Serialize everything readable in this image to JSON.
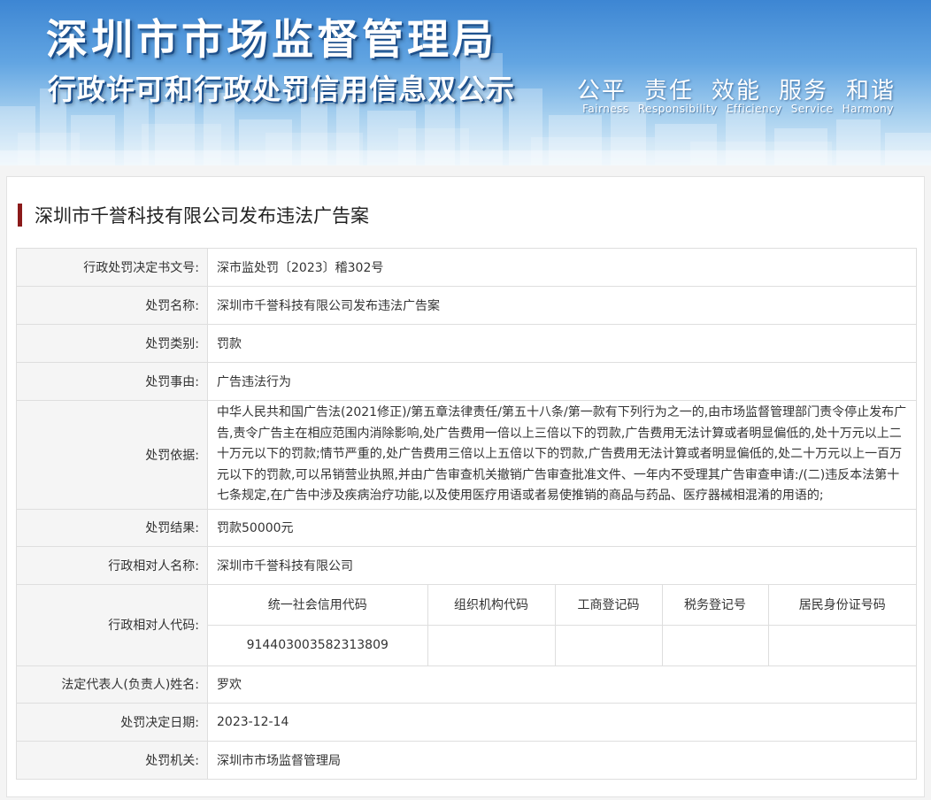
{
  "banner": {
    "title": "深圳市市场监督管理局",
    "subtitle": "行政许可和行政处罚信用信息双公示",
    "slogan_cn": [
      "公平",
      "责任",
      "效能",
      "服务",
      "和谐"
    ],
    "slogan_en": [
      "Fairness",
      "Responsibility",
      "Efficiency",
      "Service",
      "Harmony"
    ]
  },
  "case_title": "深圳市千誉科技有限公司发布违法广告案",
  "fields": {
    "doc_no": {
      "label": "行政处罚决定书文号:",
      "value": "深市监处罚〔2023〕稽302号"
    },
    "name": {
      "label": "处罚名称:",
      "value": "深圳市千誉科技有限公司发布违法广告案"
    },
    "category": {
      "label": "处罚类别:",
      "value": "罚款"
    },
    "reason": {
      "label": "处罚事由:",
      "value": "广告违法行为"
    },
    "basis": {
      "label": "处罚依据:",
      "value": "中华人民共和国广告法(2021修正)/第五章法律责任/第五十八条/第一款有下列行为之一的,由市场监督管理部门责令停止发布广告,责令广告主在相应范围内消除影响,处广告费用一倍以上三倍以下的罚款,广告费用无法计算或者明显偏低的,处十万元以上二十万元以下的罚款;情节严重的,处广告费用三倍以上五倍以下的罚款,广告费用无法计算或者明显偏低的,处二十万元以上一百万元以下的罚款,可以吊销营业执照,并由广告审查机关撤销广告审查批准文件、一年内不受理其广告审查申请:/(二)违反本法第十七条规定,在广告中涉及疾病治疗功能,以及使用医疗用语或者易使推销的商品与药品、医疗器械相混淆的用语的;"
    },
    "result": {
      "label": "处罚结果:",
      "value": "罚款50000元"
    },
    "party_name": {
      "label": "行政相对人名称:",
      "value": "深圳市千誉科技有限公司"
    },
    "party_code": {
      "label": "行政相对人代码:",
      "headers": [
        "统一社会信用代码",
        "组织机构代码",
        "工商登记码",
        "税务登记号",
        "居民身份证号码"
      ],
      "values": [
        "914403003582313809",
        "",
        "",
        "",
        ""
      ]
    },
    "legal_rep": {
      "label": "法定代表人(负责人)姓名:",
      "value": "罗欢"
    },
    "date": {
      "label": "处罚决定日期:",
      "value": "2023-12-14"
    },
    "authority": {
      "label": "处罚机关:",
      "value": "深圳市市场监督管理局"
    }
  }
}
